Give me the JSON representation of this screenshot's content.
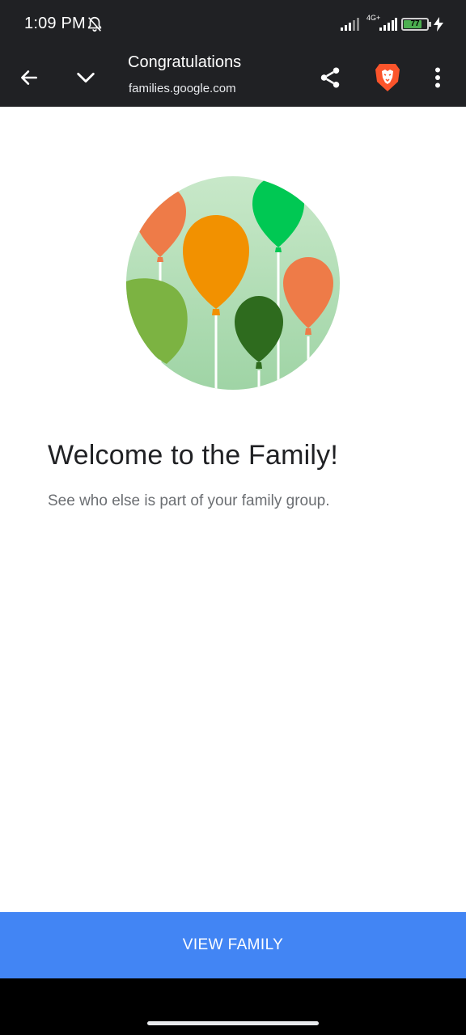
{
  "status_bar": {
    "time": "1:09 PM",
    "network_label": "4G+",
    "battery_level": "77",
    "battery_percent": 77
  },
  "toolbar": {
    "title": "Congratulations",
    "url": "families.google.com",
    "icons": [
      "back-arrow-icon",
      "chevron-down-icon",
      "share-icon",
      "brave-lion-icon",
      "more-vert-icon"
    ]
  },
  "main": {
    "heading": "Welcome to the Family!",
    "subtext": "See who else is part of your family group."
  },
  "cta": {
    "label": "VIEW FAMILY"
  },
  "colors": {
    "toolbar_bg": "#202124",
    "cta_bg": "#4285f4",
    "brave_orange": "#fb542b",
    "circle_green": "#b3dfb7",
    "balloon_orange": "#ee7b48",
    "balloon_amber": "#f29100",
    "balloon_green": "#00c853",
    "balloon_lime": "#7cb342",
    "balloon_darkgreen": "#2e6b1e"
  }
}
